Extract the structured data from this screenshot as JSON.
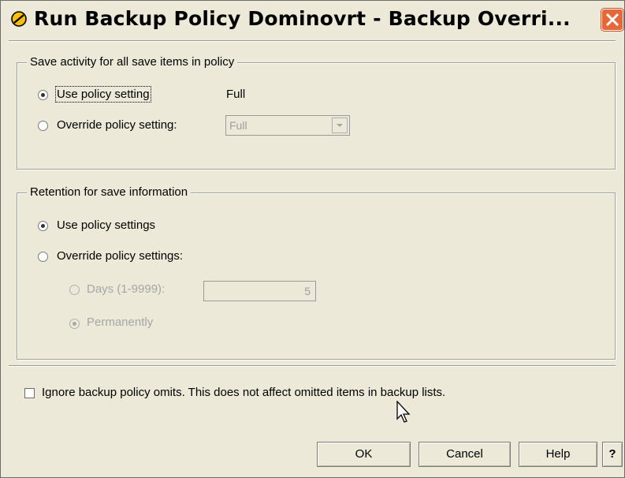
{
  "window": {
    "title": "Run Backup Policy Dominovrt - Backup Overri...",
    "close_icon": "close-x-icon",
    "app_icon": "ibm-navigator-icon"
  },
  "save_activity": {
    "legend": "Save activity for all save items in policy",
    "use_policy_label": "Use policy setting",
    "use_policy_value": "Full",
    "override_label": "Override policy setting:",
    "override_combo_value": "Full",
    "selected": "use_policy"
  },
  "retention": {
    "legend": "Retention for save information",
    "use_policy_label": "Use policy settings",
    "override_label": "Override policy settings:",
    "days_label": "Days (1-9999):",
    "days_value": "5",
    "permanently_label": "Permanently",
    "selected": "use_policy",
    "sub_selected": "permanently"
  },
  "omits": {
    "label": "Ignore backup policy omits.  This does not affect omitted items in backup lists.",
    "checked": false
  },
  "buttons": {
    "ok": "OK",
    "cancel": "Cancel",
    "help": "Help",
    "context_help": "?"
  },
  "colors": {
    "dialog_bg": "#ece9d8",
    "close_button": "#e4683a",
    "disabled_text": "#a6a6a6"
  }
}
